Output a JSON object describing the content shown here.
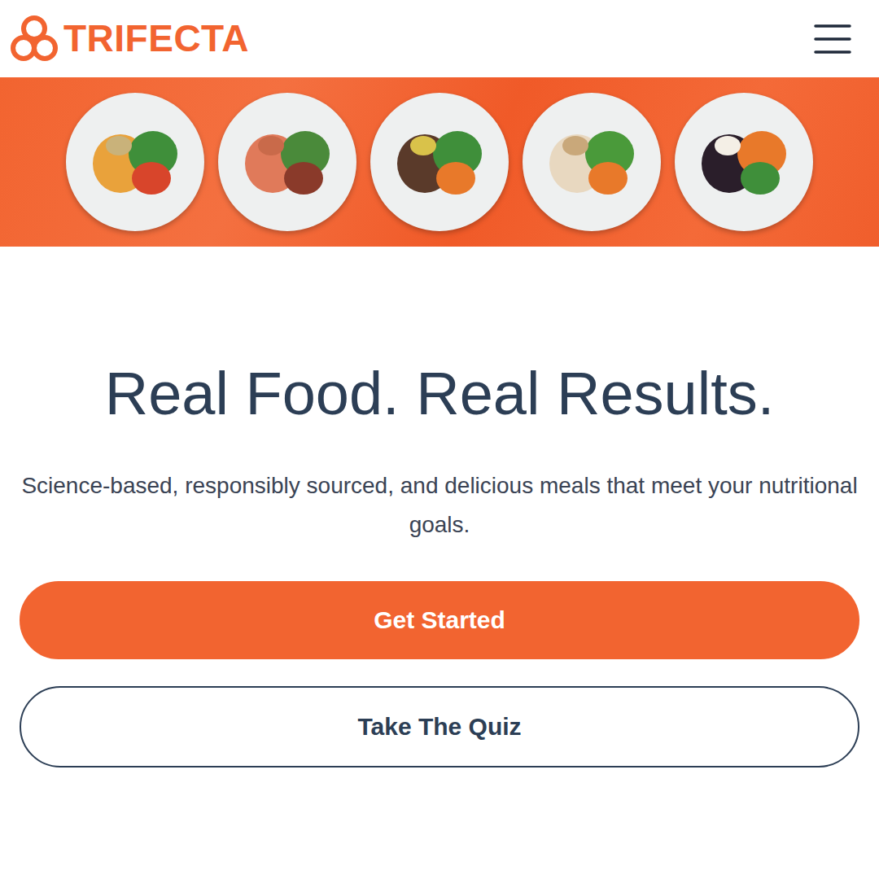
{
  "header": {
    "logo": "TRIFECTA"
  },
  "hero": {
    "title": "Real Food. Real Results.",
    "subtitle": "Science-based, responsibly sourced, and delicious meals that meet your nutritional goals."
  },
  "buttons": [
    {
      "label": "Get Started",
      "kind": "primary"
    },
    {
      "label": "Take The Quiz",
      "kind": "outline"
    }
  ]
}
